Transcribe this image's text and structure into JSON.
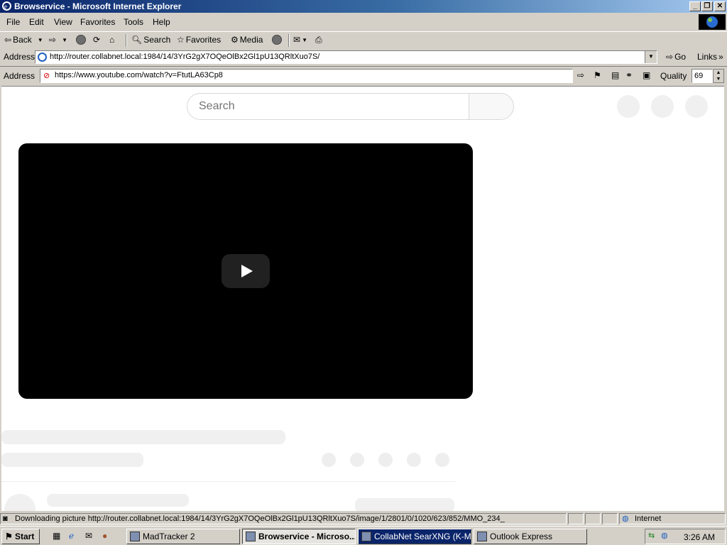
{
  "window": {
    "title": "Browservice - Microsoft Internet Explorer"
  },
  "menu": [
    "File",
    "Edit",
    "View",
    "Favorites",
    "Tools",
    "Help"
  ],
  "toolbar": {
    "back": "Back",
    "search": "Search",
    "favorites": "Favorites",
    "media": "Media"
  },
  "ie_address": {
    "label": "Address",
    "url": "http://router.collabnet.local:1984/14/3YrG2gX7OQeOlBx2Gl1pU13QRltXuo7S/",
    "go": "Go",
    "links": "Links"
  },
  "bs_address": {
    "label": "Address",
    "url": "https://www.youtube.com/watch?v=FtutLA63Cp8",
    "quality_label": "Quality",
    "quality_value": "69"
  },
  "page": {
    "search_placeholder": "Search"
  },
  "status": {
    "text": "Downloading picture http://router.collabnet.local:1984/14/3YrG2gX7OQeOlBx2Gl1pU13QRltXuo7S/image/1/2801/0/1020/623/852/MMO_234_",
    "zone": "Internet"
  },
  "taskbar": {
    "start": "Start",
    "tasks": [
      "MadTracker 2",
      "Browservice - Microso...",
      "CollabNet SearXNG (K-Mel...",
      "Outlook Express"
    ],
    "clock": "3:26 AM"
  }
}
